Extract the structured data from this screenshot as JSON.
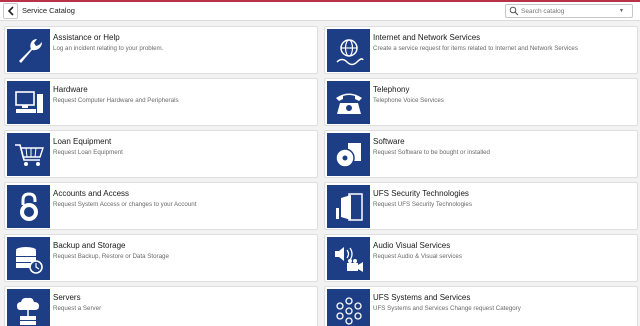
{
  "header": {
    "title": "Service Catalog",
    "search_placeholder": "Search catalog"
  },
  "categories": [
    {
      "title": "Assistance or Help",
      "description": "Log an incident relating to your problem.",
      "icon": "wrench-icon"
    },
    {
      "title": "Internet and Network Services",
      "description": "Create a service request for items related to Internet and Network Services",
      "icon": "globe-network-icon"
    },
    {
      "title": "Hardware",
      "description": "Request Computer Hardware and Peripherals",
      "icon": "computer-icon"
    },
    {
      "title": "Telephony",
      "description": "Telephone Voice Services",
      "icon": "telephone-icon"
    },
    {
      "title": "Loan Equipment",
      "description": "Request Loan Equipment",
      "icon": "shopping-cart-icon"
    },
    {
      "title": "Software",
      "description": "Request Software to be bought or installed",
      "icon": "software-disc-icon"
    },
    {
      "title": "Accounts and Access",
      "description": "Request System Access or changes to your Account",
      "icon": "padlock-icon"
    },
    {
      "title": "UFS Security Technologies",
      "description": "Request UFS Security Technologies",
      "icon": "door-icon"
    },
    {
      "title": "Backup and Storage",
      "description": "Request Backup, Restore or Data Storage",
      "icon": "database-backup-icon"
    },
    {
      "title": "Audio Visual Services",
      "description": "Request Audio & Visual services",
      "icon": "speaker-camera-icon"
    },
    {
      "title": "Servers",
      "description": "Request a Server",
      "icon": "server-cloud-icon"
    },
    {
      "title": "UFS Systems and Services",
      "description": "UFS Systems and Services Change request Category",
      "icon": "systems-circles-icon"
    }
  ]
}
